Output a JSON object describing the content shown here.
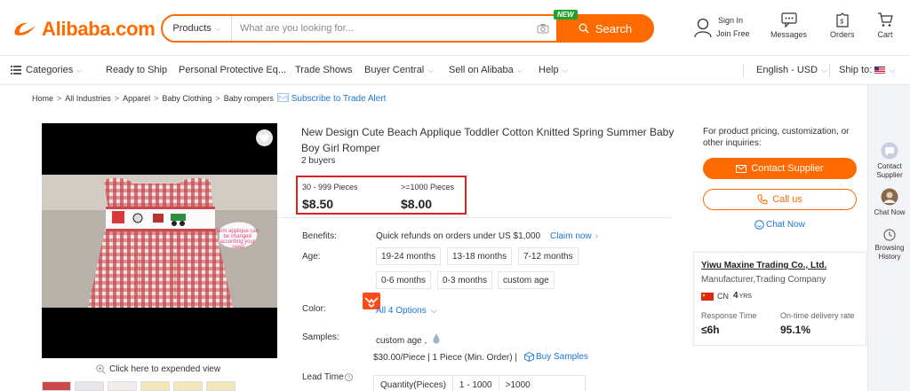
{
  "brand": {
    "name": "Alibaba.com",
    "accent": "#ff6a00"
  },
  "search": {
    "category": "Products",
    "placeholder": "What are you looking for...",
    "button": "Search",
    "badge": "NEW"
  },
  "header_actions": {
    "sign_in": "Sign In",
    "join": "Join Free",
    "messages": "Messages",
    "orders": "Orders",
    "cart": "Cart"
  },
  "nav": {
    "categories": "Categories",
    "items": [
      "Ready to Ship",
      "Personal Protective Eq...",
      "Trade Shows",
      "Buyer Central",
      "Sell on Alibaba",
      "Help"
    ],
    "language": "English - USD",
    "ship_to": "Ship to:"
  },
  "breadcrumb": [
    "Home",
    "All Industries",
    "Apparel",
    "Baby Clothing",
    "Baby rompers"
  ],
  "trade_alert": "Subscribe to Trade Alert",
  "gallery": {
    "expand_text": "Click here to expended view",
    "callout": "farm applique can be changed according your need"
  },
  "product": {
    "title": "New Design Cute Beach Applique Toddler Cotton Knitted Spring Summer Baby Boy Girl Romper",
    "buyers": "2 buyers",
    "tiers": [
      {
        "range": "30 - 999 Pieces",
        "price": "$8.50"
      },
      {
        "range": ">=1000 Pieces",
        "price": "$8.00"
      }
    ],
    "benefits_label": "Benefits:",
    "benefits_text": "Quick refunds on orders under US $1,000",
    "claim": "Claim now",
    "age_label": "Age:",
    "ages": [
      "19-24 months",
      "13-18 months",
      "7-12 months",
      "0-6 months",
      "0-3 months",
      "custom age"
    ],
    "color_label": "Color:",
    "color_options": "All 4 Options",
    "samples_label": "Samples:",
    "sample_name": "custom age ,",
    "sample_price": "$30.00/Piece | 1 Piece (Min. Order) |",
    "buy_samples": "Buy Samples",
    "lead_label": "Lead Time",
    "lead_table": [
      "Quantity(Pieces)",
      "1 - 1000",
      ">1000"
    ]
  },
  "contact": {
    "inquiry": "For product pricing, customization, or other inquiries:",
    "contact_supplier": "Contact Supplier",
    "call_us": "Call us",
    "chat_now": "Chat Now"
  },
  "supplier": {
    "name": "Yiwu Maxine Trading Co., Ltd.",
    "type": "Manufacturer,Trading Company",
    "country": "CN",
    "years": "4",
    "years_unit": "YRS",
    "response_label": "Response Time",
    "response_value": "≤6h",
    "delivery_label": "On-time delivery rate",
    "delivery_value": "95.1%"
  },
  "rail": {
    "contact": [
      "Contact",
      "Supplier"
    ],
    "chat": "Chat Now",
    "history": [
      "Browsing",
      "History"
    ]
  }
}
